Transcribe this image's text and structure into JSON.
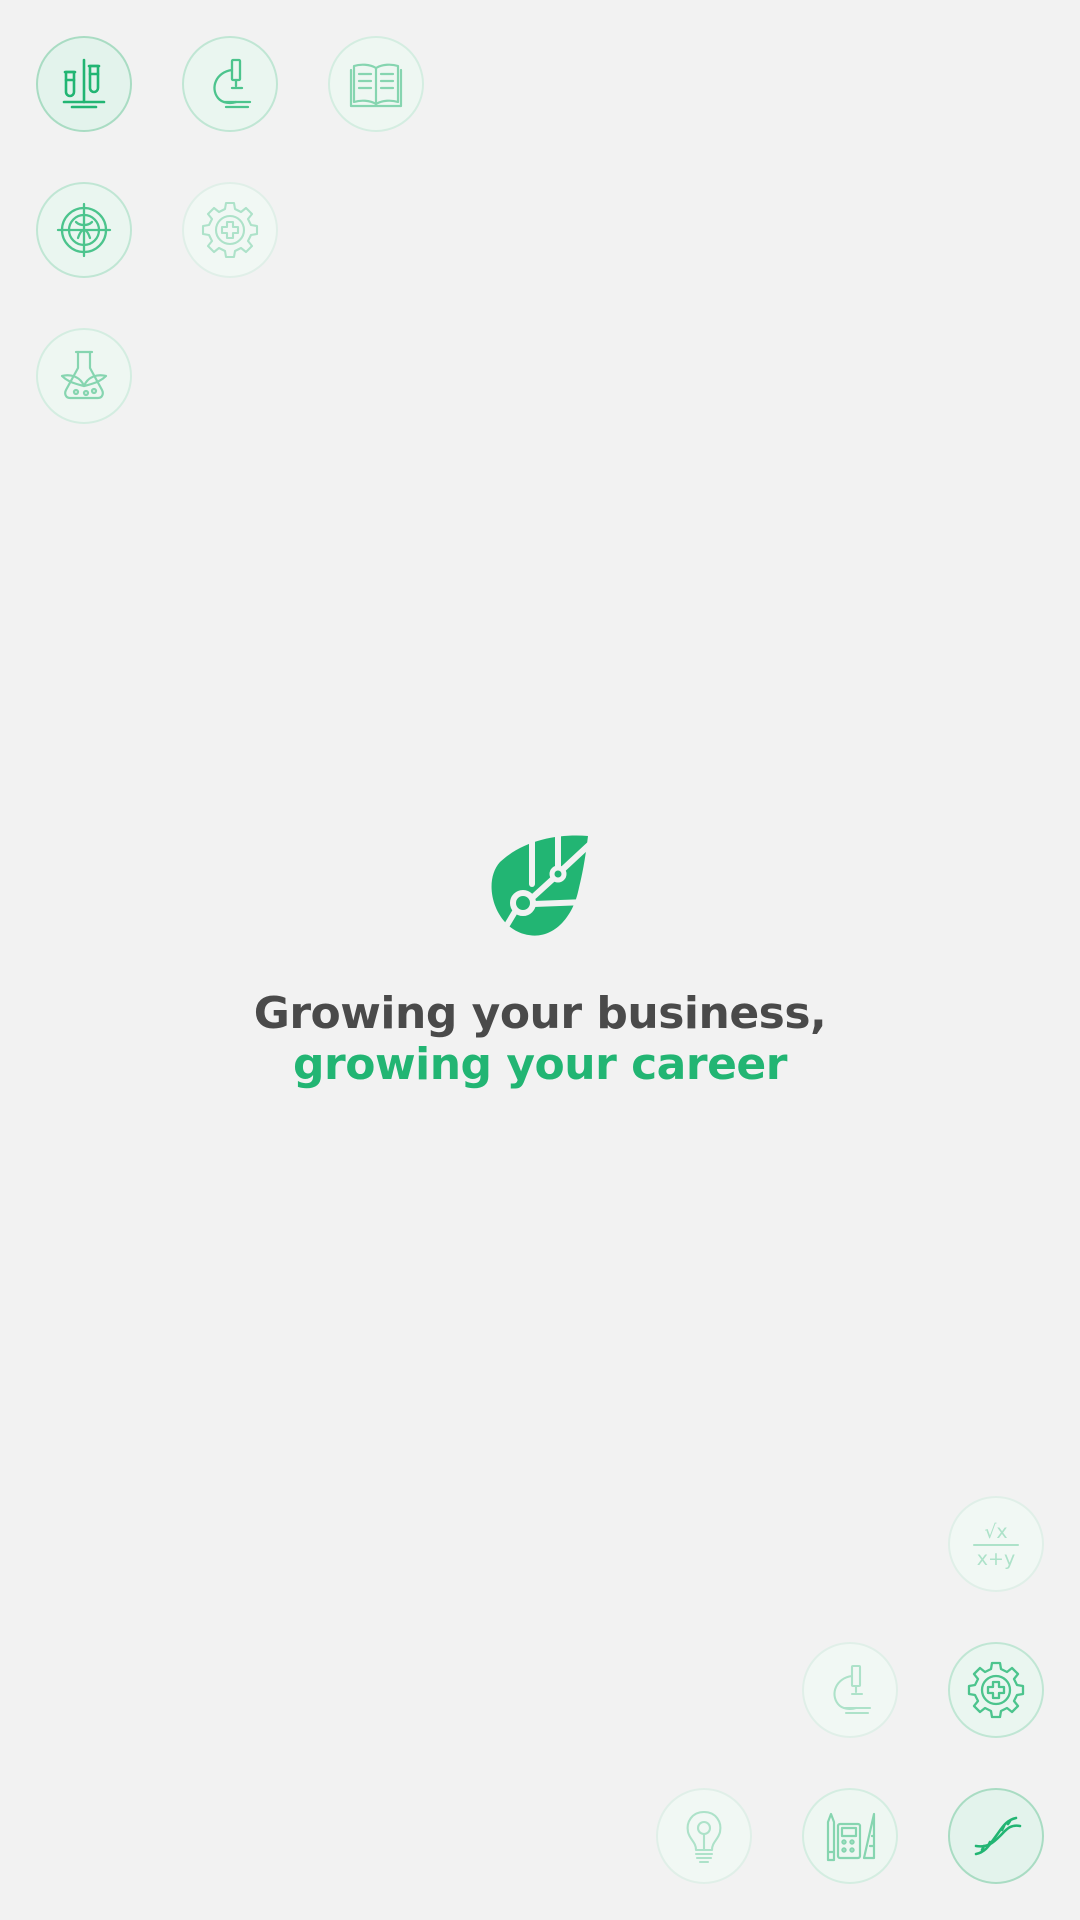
{
  "headline": {
    "line1": "Growing your business,",
    "line2": "growing your career"
  },
  "colors": {
    "background": "#f2f2f2",
    "brand_green": "#22b573",
    "headline_dark": "#4a4a4a"
  },
  "icons": {
    "top_left": [
      "test-tubes",
      "microscope",
      "open-book",
      "virus-target",
      "medical-gear",
      "plant-flask"
    ],
    "bottom_right": [
      "math-formula",
      "microscope",
      "medical-gear",
      "lightbulb-idea",
      "calculator-ruler-pencil",
      "dna"
    ],
    "logo": "leaf-circuit-logo"
  },
  "math_icon": {
    "top": "√x",
    "bottom": "x+y"
  }
}
